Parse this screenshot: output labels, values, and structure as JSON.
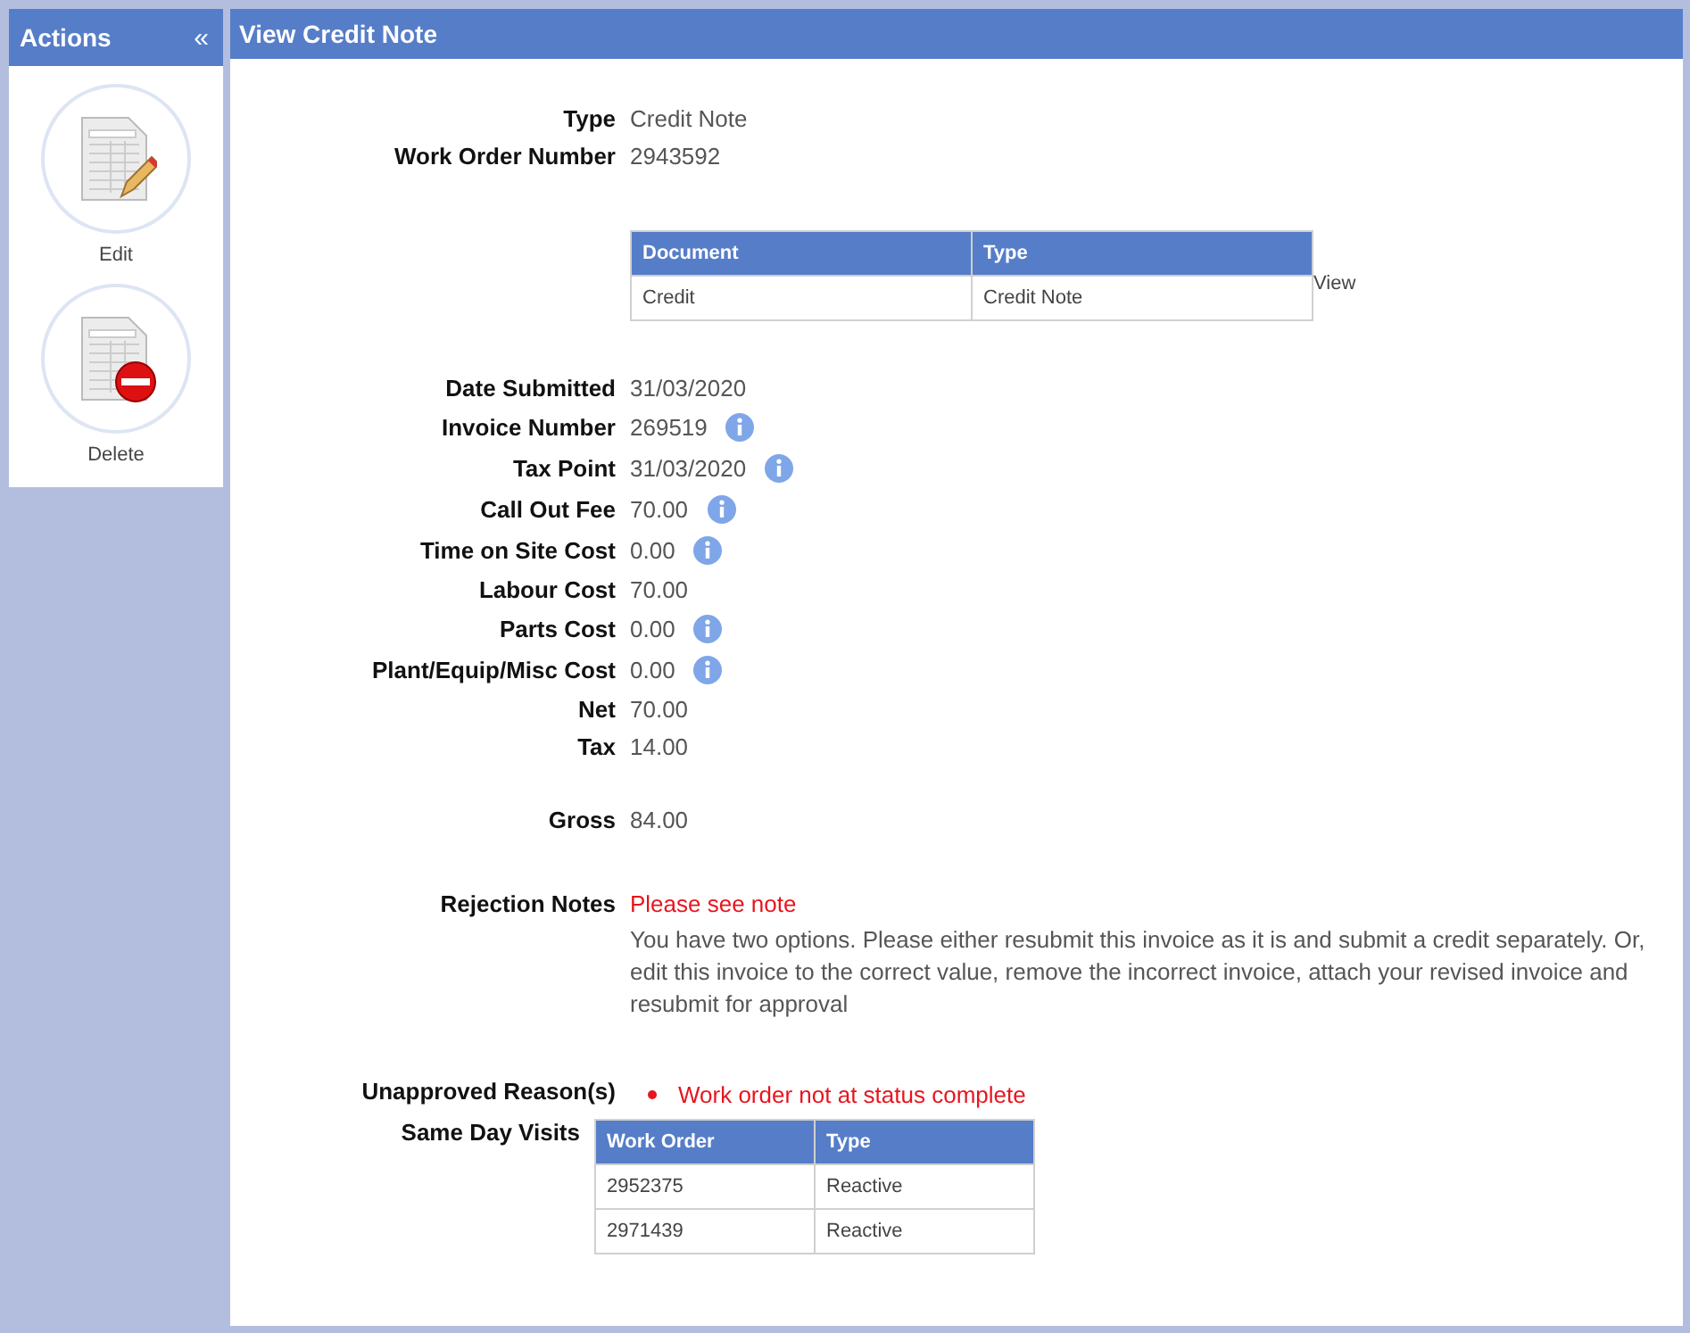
{
  "sidebar": {
    "title": "Actions",
    "collapse_glyph": "«",
    "actions": [
      {
        "label": "Edit",
        "kind": "edit"
      },
      {
        "label": "Delete",
        "kind": "delete"
      }
    ]
  },
  "panel": {
    "title": "View Credit Note"
  },
  "summary": [
    {
      "label": "Type",
      "value": "Credit Note"
    },
    {
      "label": "Work Order Number",
      "value": "2943592"
    }
  ],
  "documents": {
    "columns": [
      "Document",
      "Type"
    ],
    "rows": [
      [
        "Credit",
        "Credit Note"
      ]
    ],
    "link": "View"
  },
  "fields": [
    {
      "label": "Date Submitted",
      "value": "31/03/2020",
      "info": false
    },
    {
      "label": "Invoice Number",
      "value": "269519",
      "info": true
    },
    {
      "label": "Tax Point",
      "value": "31/03/2020",
      "info": true
    },
    {
      "label": "Call Out Fee",
      "value": "70.00",
      "info": true
    },
    {
      "label": "Time on Site Cost",
      "value": "0.00",
      "info": true
    },
    {
      "label": "Labour Cost",
      "value": "70.00",
      "info": false
    },
    {
      "label": "Parts Cost",
      "value": "0.00",
      "info": true
    },
    {
      "label": "Plant/Equip/Misc Cost",
      "value": "0.00",
      "info": true
    },
    {
      "label": "Net",
      "value": "70.00",
      "info": false
    },
    {
      "label": "Tax",
      "value": "14.00",
      "info": false
    },
    {
      "label": "Gross",
      "value": "84.00",
      "info": false
    }
  ],
  "rejection": {
    "label": "Rejection Notes",
    "link": "Please see note",
    "text": "You have two options. Please either resubmit this invoice as it is and submit a credit separately. Or, edit this invoice to the correct value, remove the incorrect invoice, attach your revised invoice and resubmit for approval"
  },
  "unapproved": {
    "label": "Unapproved Reason(s)",
    "reasons": [
      "Work order not at status complete"
    ]
  },
  "same_day_visits": {
    "label": "Same Day Visits",
    "columns": [
      "Work Order",
      "Type"
    ],
    "rows": [
      [
        "2952375",
        "Reactive"
      ],
      [
        "2971439",
        "Reactive"
      ]
    ]
  }
}
